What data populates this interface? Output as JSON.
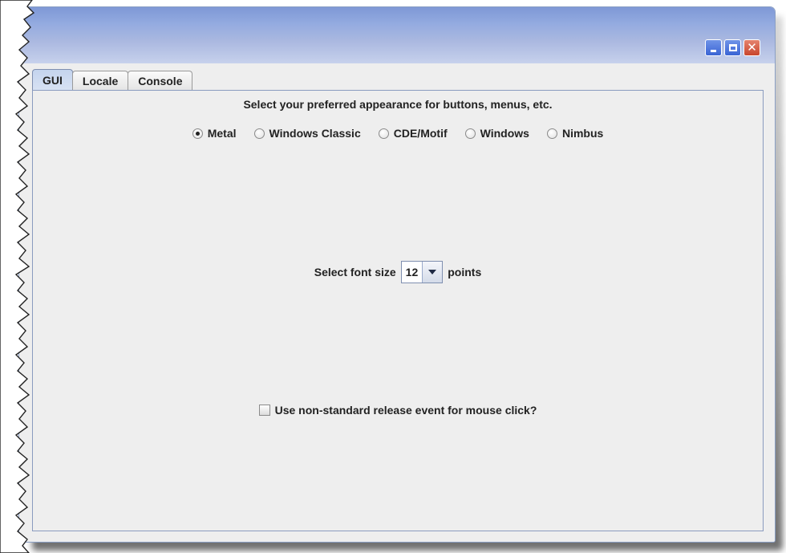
{
  "window": {
    "title": "",
    "controls": {
      "minimize_icon": "minimize-icon",
      "maximize_icon": "maximize-icon",
      "close_icon": "close-icon"
    }
  },
  "tabs": [
    {
      "label": "GUI",
      "active": true
    },
    {
      "label": "Locale",
      "active": false
    },
    {
      "label": "Console",
      "active": false
    }
  ],
  "appearance": {
    "heading": "Select your preferred appearance for buttons, menus, etc.",
    "options": [
      {
        "label": "Metal",
        "selected": true
      },
      {
        "label": "Windows Classic",
        "selected": false
      },
      {
        "label": "CDE/Motif",
        "selected": false
      },
      {
        "label": "Windows",
        "selected": false
      },
      {
        "label": "Nimbus",
        "selected": false
      }
    ]
  },
  "font_size": {
    "prefix": "Select font size",
    "value": "12",
    "suffix": "points"
  },
  "mouse_option": {
    "label": "Use non-standard release event for mouse click?",
    "checked": false
  },
  "colors": {
    "title_bar": "#94abe0",
    "close_button": "#c8452d",
    "panel_border": "#8a9bbf",
    "background": "#eeeeee"
  }
}
